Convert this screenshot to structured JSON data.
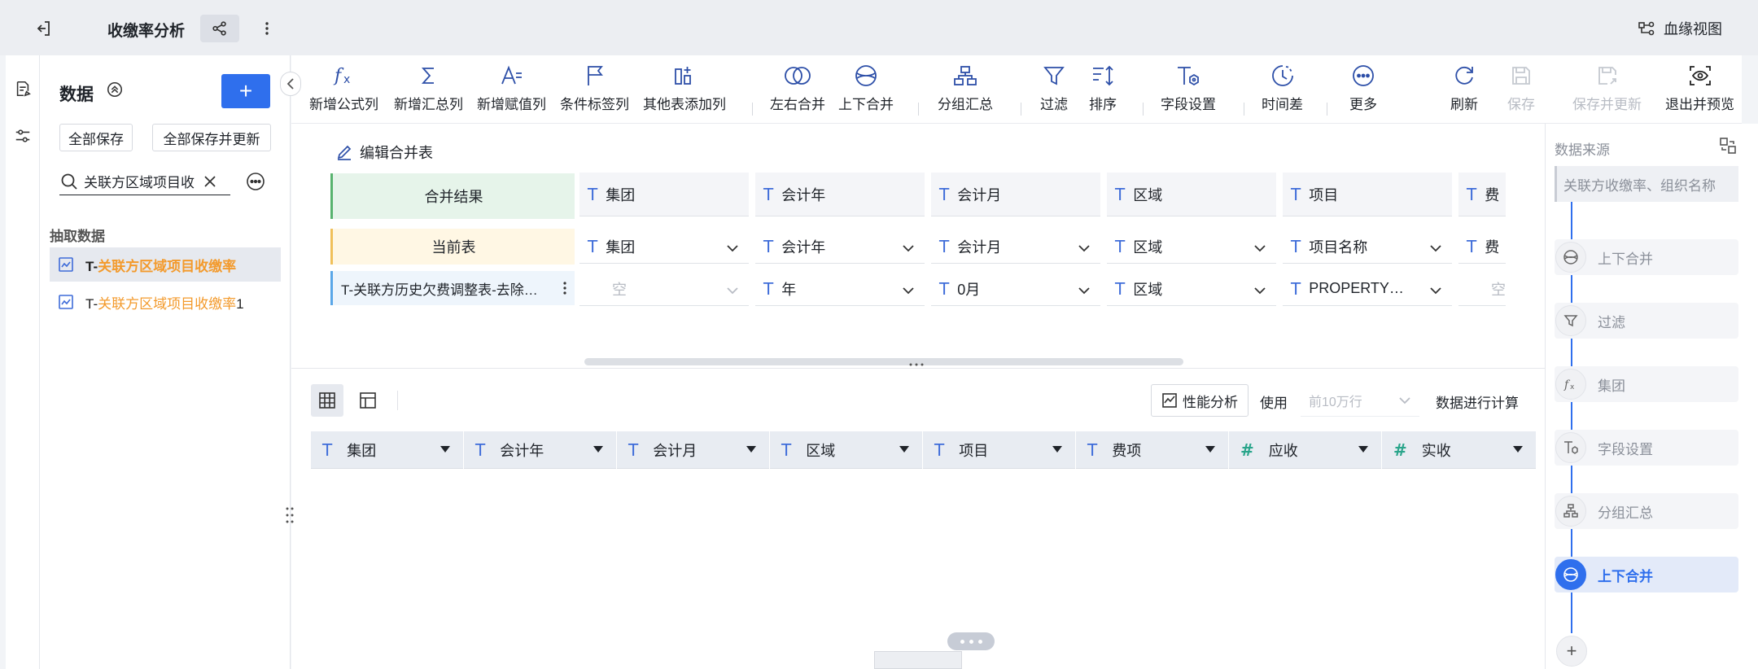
{
  "app": {
    "title": "收缴率分析",
    "lineage_label": "血缘视图"
  },
  "data_panel": {
    "title": "数据",
    "add_label": "+",
    "save_all": "全部保存",
    "save_all_update": "全部保存并更新",
    "search_value": "关联方区域项目收",
    "section_title": "抽取数据",
    "items": [
      {
        "prefix": "T-",
        "highlight": "关联方区域项目收缴率",
        "suffix": "",
        "selected": true
      },
      {
        "prefix": "T-",
        "highlight": "关联方区域项目收缴率",
        "suffix": "1",
        "selected": false
      }
    ]
  },
  "toolbar": {
    "items": [
      {
        "label": "新增公式列",
        "icon": "fx-icon"
      },
      {
        "label": "新增汇总列",
        "icon": "sigma-icon"
      },
      {
        "label": "新增赋值列",
        "icon": "assign-icon"
      },
      {
        "label": "条件标签列",
        "icon": "flag-icon"
      },
      {
        "label": "其他表添加列",
        "icon": "add-column-icon"
      },
      {
        "label": "左右合并",
        "icon": "horizontal-merge-icon"
      },
      {
        "label": "上下合并",
        "icon": "vertical-merge-icon"
      },
      {
        "label": "分组汇总",
        "icon": "group-icon"
      },
      {
        "label": "过滤",
        "icon": "filter-icon"
      },
      {
        "label": "排序",
        "icon": "sort-icon"
      },
      {
        "label": "字段设置",
        "icon": "field-settings-icon"
      },
      {
        "label": "时间差",
        "icon": "clock-icon"
      },
      {
        "label": "更多",
        "icon": "more-icon"
      },
      {
        "label": "刷新",
        "icon": "refresh-icon"
      },
      {
        "label": "保存",
        "icon": "save-icon",
        "disabled": true
      },
      {
        "label": "保存并更新",
        "icon": "save-update-icon",
        "disabled": true
      },
      {
        "label": "退出并预览",
        "icon": "preview-icon"
      }
    ]
  },
  "merge": {
    "edit_label": "编辑合并表",
    "result_label": "合并结果",
    "current_label": "当前表",
    "other_table": "T-关联方历史欠费调整表-去除…",
    "result_fields": [
      "集团",
      "会计年",
      "会计月",
      "区域",
      "项目",
      "费"
    ],
    "current_fields": [
      "集团",
      "会计年",
      "会计月",
      "区域",
      "项目名称",
      "费"
    ],
    "other_fields": [
      "空",
      "年",
      "0月",
      "区域",
      "PROPERTY…",
      "空"
    ]
  },
  "preview": {
    "perf_label": "性能分析",
    "use_label": "使用",
    "rows_placeholder": "前10万行",
    "calc_label": "数据进行计算",
    "columns": [
      {
        "name": "集团",
        "type": "text"
      },
      {
        "name": "会计年",
        "type": "text"
      },
      {
        "name": "会计月",
        "type": "text"
      },
      {
        "name": "区域",
        "type": "text"
      },
      {
        "name": "项目",
        "type": "text"
      },
      {
        "name": "费项",
        "type": "text"
      },
      {
        "name": "应收",
        "type": "number"
      },
      {
        "name": "实收",
        "type": "number"
      }
    ]
  },
  "right_panel": {
    "title": "数据来源",
    "source": "关联方收缴率、组织名称",
    "steps": [
      {
        "label": "上下合并",
        "icon": "vertical-merge-icon",
        "active": false
      },
      {
        "label": "过滤",
        "icon": "filter-icon",
        "active": false
      },
      {
        "label": "集团",
        "icon": "fx-icon",
        "active": false
      },
      {
        "label": "字段设置",
        "icon": "field-settings-icon",
        "active": false
      },
      {
        "label": "分组汇总",
        "icon": "group-icon",
        "active": false
      },
      {
        "label": "上下合并",
        "icon": "vertical-merge-icon",
        "active": true
      }
    ],
    "add_label": "+"
  },
  "colors": {
    "accent": "#2f6fed",
    "highlight": "#f39a2c",
    "text_type": "#3e6cd9",
    "number_type": "#2aa58b"
  }
}
